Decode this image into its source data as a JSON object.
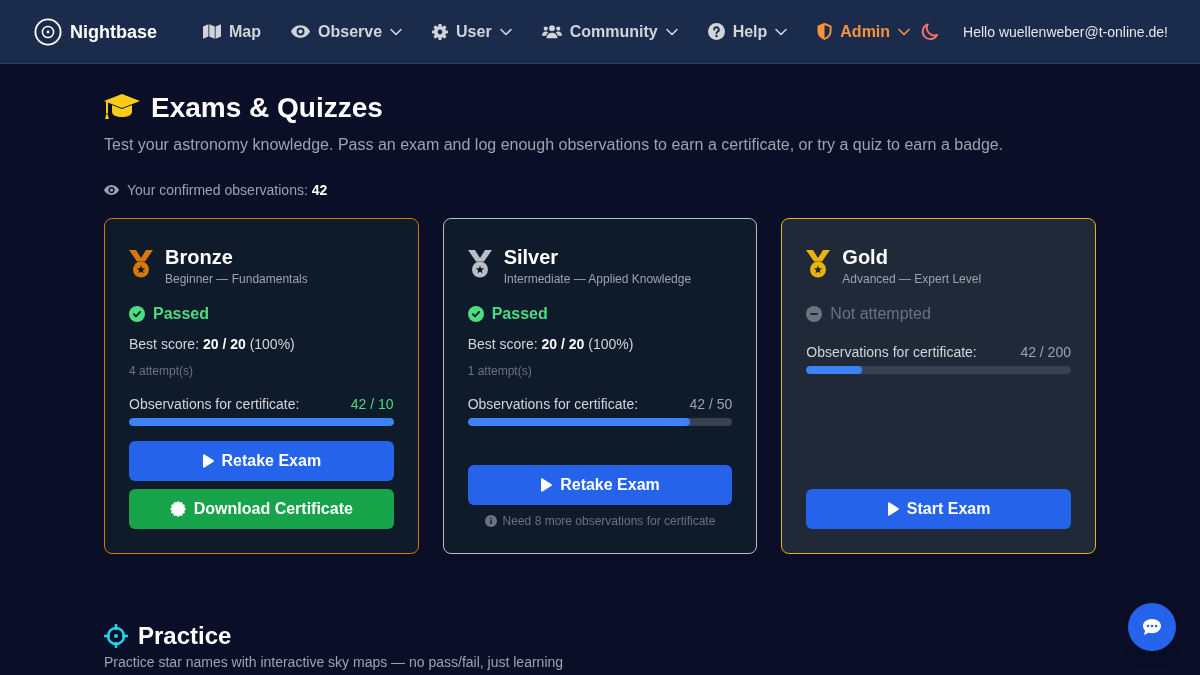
{
  "navbar": {
    "brand": "Nightbase",
    "items": [
      {
        "label": "Map",
        "dropdown": false,
        "highlighted": false
      },
      {
        "label": "Observe",
        "dropdown": true,
        "highlighted": false
      },
      {
        "label": "User",
        "dropdown": true,
        "highlighted": false
      },
      {
        "label": "Community",
        "dropdown": true,
        "highlighted": false
      },
      {
        "label": "Help",
        "dropdown": true,
        "highlighted": false
      },
      {
        "label": "Admin",
        "dropdown": true,
        "highlighted": true
      }
    ],
    "greeting": "Hello wuellenweber@t-online.de!"
  },
  "page": {
    "title": "Exams & Quizzes",
    "description": "Test your astronomy knowledge. Pass an exam and log enough observations to earn a certificate, or try a quiz to earn a badge.",
    "observations": "Your confirmed observations: **42**"
  },
  "exams": [
    {
      "title": "Bronze",
      "subtitle": "Beginner — Fundamentals",
      "color": "#d97706",
      "highlighted": false,
      "passed": true,
      "status": "Passed",
      "best_score": "Best score: **20 / 20** (100%)",
      "attempts": "4 attempt(s)",
      "progress_label": "Observations for certificate:",
      "progress_value": "42 / 10",
      "complete": true,
      "level": 1,
      "buttons": [
        {
          "label": "Retake Exam",
          "kind": "exam"
        },
        {
          "label": "Download Certificate",
          "kind": "certificate"
        }
      ]
    },
    {
      "title": "Silver",
      "subtitle": "Intermediate — Applied Knowledge",
      "color": "#b8bec8",
      "highlighted": false,
      "passed": true,
      "status": "Passed",
      "best_score": "Best score: **20 / 20** (100%)",
      "attempts": "1 attempt(s)",
      "progress_label": "Observations for certificate:",
      "progress_value": "42 / 50",
      "complete": false,
      "level": 0.84,
      "buttons": [
        {
          "label": "Retake Exam",
          "kind": "exam"
        }
      ],
      "note": "Need 8 more observations for certificate"
    },
    {
      "title": "Gold",
      "subtitle": "Advanced — Expert Level",
      "color": "#eab308",
      "highlighted": true,
      "passed": false,
      "status": "Not attempted",
      "progress_label": "Observations for certificate:",
      "progress_value": "42 / 200",
      "complete": false,
      "level": 0.21,
      "buttons": [
        {
          "label": "Start Exam",
          "kind": "exam"
        }
      ]
    }
  ],
  "practice": {
    "title": "Practice",
    "description": "Practice star names with interactive sky maps — no pass/fail, just learning"
  }
}
